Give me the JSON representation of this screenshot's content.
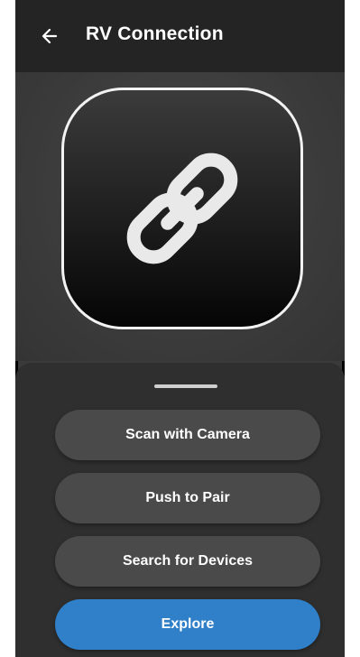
{
  "header": {
    "back_icon": "arrow-left-icon",
    "title": "RV Connection"
  },
  "hero": {
    "icon": "link-icon"
  },
  "sheet": {
    "buttons": [
      {
        "label": "Scan with Camera"
      },
      {
        "label": "Push to Pair"
      },
      {
        "label": "Search for Devices"
      },
      {
        "label": "Explore"
      }
    ]
  },
  "colors": {
    "header_bg": "#242424",
    "body_bg": "#3a3a3a",
    "button_bg": "#4a4a4a",
    "primary_button_bg": "#2f7fc9",
    "text": "#ffffff"
  }
}
